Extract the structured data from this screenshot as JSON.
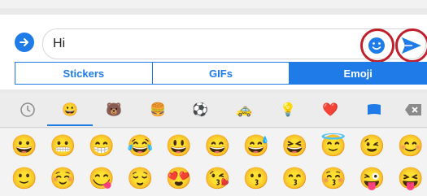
{
  "composer": {
    "input_value": "Hi"
  },
  "tabs": [
    {
      "label": "Stickers",
      "active": false
    },
    {
      "label": "GIFs",
      "active": false
    },
    {
      "label": "Emoji",
      "active": true
    }
  ],
  "categories": [
    {
      "name": "recent-icon",
      "glyph": "🕒"
    },
    {
      "name": "smileys-icon",
      "glyph": "😀"
    },
    {
      "name": "animals-icon",
      "glyph": "🐻"
    },
    {
      "name": "food-icon",
      "glyph": "🍔"
    },
    {
      "name": "activity-icon",
      "glyph": "⚽"
    },
    {
      "name": "travel-icon",
      "glyph": "🚕"
    },
    {
      "name": "objects-icon",
      "glyph": "💡"
    },
    {
      "name": "symbols-icon",
      "glyph": "❤️"
    },
    {
      "name": "flags-icon",
      "glyph": "🏴"
    },
    {
      "name": "backspace-icon",
      "glyph": "⌫"
    }
  ],
  "emoji_rows": [
    [
      "😀",
      "😬",
      "😁",
      "😂",
      "😃",
      "😄",
      "😅",
      "😆",
      "😇",
      "😉",
      "😊"
    ],
    [
      "🙂",
      "☺️",
      "😋",
      "😌",
      "😍",
      "😘",
      "😗",
      "😙",
      "😚",
      "😜",
      "😝"
    ]
  ],
  "colors": {
    "accent": "#1e7be8",
    "highlight_ring": "#c0202c"
  }
}
